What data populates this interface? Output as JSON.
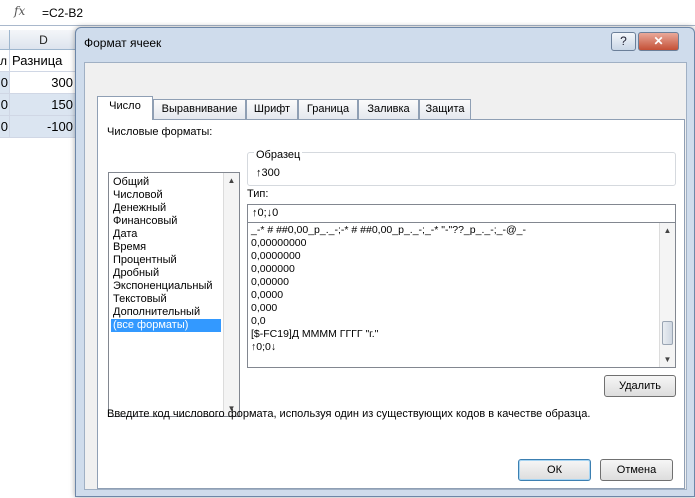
{
  "excel": {
    "fx_label": "fx",
    "formula": "=C2-B2",
    "columns": [
      "D"
    ],
    "col_c_header_tail": "л",
    "header_cell": "Разница",
    "rows": [
      {
        "left": "0",
        "value": "300"
      },
      {
        "left": "0",
        "value": "150"
      },
      {
        "left": "0",
        "value": "-100"
      }
    ]
  },
  "dialog": {
    "title": "Формат ячеек",
    "help_button": "?",
    "close_button": "✕",
    "tabs": [
      "Число",
      "Выравнивание",
      "Шрифт",
      "Граница",
      "Заливка",
      "Защита"
    ],
    "number_formats_label": "Числовые форматы:",
    "categories": [
      "Общий",
      "Числовой",
      "Денежный",
      "Финансовый",
      "Дата",
      "Время",
      "Процентный",
      "Дробный",
      "Экспоненциальный",
      "Текстовый",
      "Дополнительный",
      "(все форматы)"
    ],
    "selected_category": "(все форматы)",
    "sample_label": "Образец",
    "sample_value": "↑300",
    "type_label": "Тип:",
    "type_value": "↑0;↓0",
    "format_list": [
      "_-* # ##0,00_р_._-;-* # ##0,00_р_._-;_-* \"-\"??_р_._-;_-@_-",
      "0,00000000",
      "0,0000000",
      "0,000000",
      "0,00000",
      "0,0000",
      "0,000",
      "0,0",
      "[$-FC19]Д ММММ ГГГГ \"г.\"",
      "↑0;0↓"
    ],
    "delete_button": "Удалить",
    "hint": "Введите код числового формата, используя один из существующих кодов в качестве образца.",
    "ok_button": "ОК",
    "cancel_button": "Отмена"
  }
}
